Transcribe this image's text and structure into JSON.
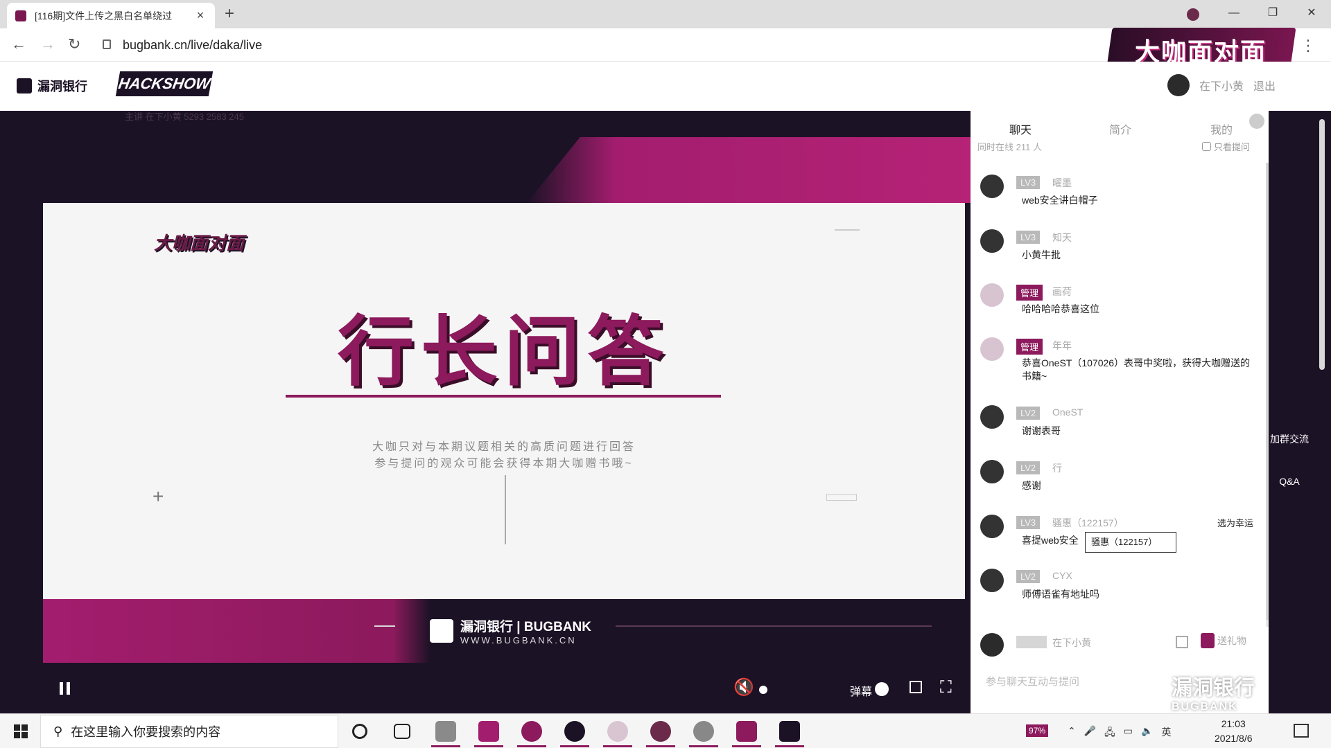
{
  "browser": {
    "tab_title": "[116期]文件上传之黑白名单绕过",
    "url": "bugbank.cn/live/daka/live"
  },
  "site": {
    "logo_text": "漏洞银行",
    "hackshow": "HACKSHOW",
    "brand_art": "大咖面对面",
    "user_name": "在下小黄",
    "logout": "退出"
  },
  "video": {
    "meta": "主讲 在下小黄   5293   2583   245",
    "slide_badge": "大咖面对面",
    "slide_title": "行长问答",
    "slide_sub1": "大咖只对与本期议题相关的高质问题进行回答",
    "slide_sub2": "参与提问的观众可能会获得本期大咖赠书哦~",
    "bugbank_main": "漏洞银行 | BUGBANK",
    "bugbank_web": "WWW.BUGBANK.CN",
    "danmu_label": "弹幕"
  },
  "chat": {
    "tabs": [
      "聊天",
      "简介",
      "我的"
    ],
    "online": "同时在线 211 人",
    "only_questions": "只看提问",
    "messages": [
      {
        "level": "LV3",
        "nick": "曜墨",
        "text": "web安全讲白帽子",
        "admin": false
      },
      {
        "level": "LV3",
        "nick": "知天",
        "text": "小黄牛批",
        "admin": false
      },
      {
        "level": "管理",
        "nick": "画荷",
        "text": "哈哈哈哈恭喜这位",
        "admin": true
      },
      {
        "level": "管理",
        "nick": "年年",
        "text": "恭喜OneST（107026）表哥中奖啦，获得大咖赠送的书籍~",
        "admin": true
      },
      {
        "level": "LV2",
        "nick": "OneST",
        "text": "谢谢表哥",
        "admin": false
      },
      {
        "level": "LV2",
        "nick": "行",
        "text": "感谢",
        "admin": false
      },
      {
        "level": "LV3",
        "nick": "骚惠（122157）",
        "text": "喜提web安全",
        "admin": false,
        "select_lucky": "选为幸运"
      },
      {
        "level": "LV2",
        "nick": "CYX",
        "text": "师傅语雀有地址吗",
        "admin": false
      }
    ],
    "tooltip": "骚惠（122157）",
    "me_nick": "在下小黄",
    "gift_label": "送礼物",
    "input_placeholder": "参与聊天互动与提问",
    "watermark_main": "漏洞银行",
    "watermark_sub": "BUGBANK"
  },
  "side": {
    "join_group": "加群交流",
    "qa": "Q&A"
  },
  "taskbar": {
    "search_placeholder": "在这里输入你要搜索的内容",
    "battery": "97%",
    "time": "21:03",
    "date": "2021/8/6"
  },
  "colors": {
    "accent": "#8c1a5c",
    "dark_bg": "#1c1226"
  }
}
